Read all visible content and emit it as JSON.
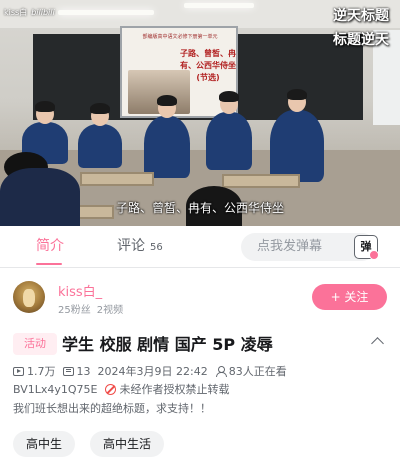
{
  "video": {
    "watermark_user": "kiss白",
    "watermark_brand": "bilibili",
    "corner_title_line1": "逆天标题",
    "corner_title_line2": "标题逆天",
    "subtitle": "子路、曾皙、冉有、公西华侍坐",
    "screen_caption": "子路、曾皙、冉有、公西华侍坐 (节选)",
    "screen_heading": "部编版高中语文必修下册第一单元"
  },
  "tabs": [
    {
      "label": "简介",
      "active": true
    },
    {
      "label": "评论",
      "count": "56",
      "active": false
    }
  ],
  "danmu": {
    "placeholder": "点我发弹幕",
    "button_label": "弹"
  },
  "uploader": {
    "name": "kiss白_",
    "fans": "25粉丝",
    "videos": "2视频",
    "follow_label": "+ 关注"
  },
  "info": {
    "activity_tag": "活动",
    "title": "学生 校服 剧情 国产 5P 凌辱",
    "views": "1.7万",
    "danmaku": "13",
    "date": "2024年3月9日 22:42",
    "watching": "83人正在看",
    "bvid": "BV1Lx4y1Q75E",
    "copyright": "未经作者授权禁止转载",
    "description": "我们班长想出来的超绝标题，求支持！！"
  },
  "tags": [
    "高中生",
    "高中生活"
  ],
  "colors": {
    "accent": "#fb7299",
    "text": "#18191c",
    "secondary": "#61666d",
    "muted": "#9499a0"
  }
}
